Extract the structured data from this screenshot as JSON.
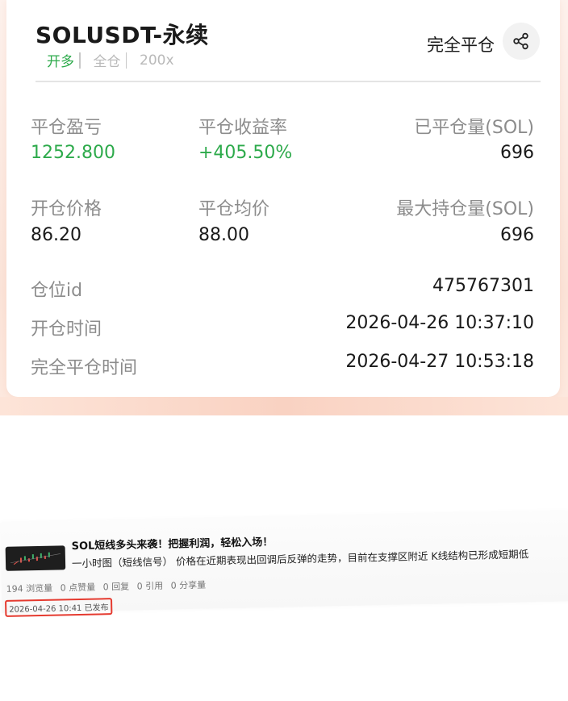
{
  "header": {
    "symbol_title": "SOLUSDT-永续",
    "tags": [
      "开多",
      "全仓",
      "200x"
    ],
    "close_all_label": "完全平仓",
    "share_icon": "share-icon"
  },
  "stats": {
    "close_pnl_label": "平仓盈亏",
    "close_pnl_value": "1252.800",
    "close_yield_label": "平仓收益率",
    "close_yield_value": "+405.50%",
    "closed_qty_label": "已平仓量(SOL)",
    "closed_qty_value": "696",
    "open_price_label": "开仓价格",
    "open_price_value": "86.20",
    "close_avg_label": "平仓均价",
    "close_avg_value": "88.00",
    "max_pos_label": "最大持仓量(SOL)",
    "max_pos_value": "696"
  },
  "details": {
    "position_id_label": "仓位id",
    "position_id_value": "475767301",
    "open_time_label": "开仓时间",
    "open_time_value": "2026-04-26 10:37:10",
    "close_time_label": "完全平仓时间",
    "close_time_value": "2026-04-27 10:53:18"
  },
  "post": {
    "title": "SOL短线多头来袭！把握利润，轻松入场！",
    "description": "一小时图（短线信号） 价格在近期表现出回调后反弹的走势，目前在支撑区附近 K线结构已形成短期低",
    "stats": [
      "194 浏览量",
      "0 点赞量",
      "0 回复",
      "0 引用",
      "0 分享量"
    ],
    "date": "2026-04-26 10:41 已发布"
  },
  "colors": {
    "positive": "#2daa4b",
    "highlight_border": "#e53a2f"
  }
}
